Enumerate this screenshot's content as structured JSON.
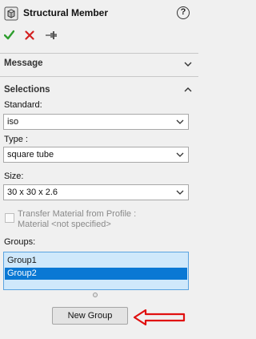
{
  "header": {
    "title": "Structural Member",
    "feature_icon": "structural-member-icon",
    "help_label": "?",
    "ok_icon": "checkmark-icon",
    "cancel_icon": "x-icon",
    "pin_icon": "pushpin-icon"
  },
  "message_section": {
    "title": "Message"
  },
  "selections_section": {
    "title": "Selections",
    "standard": {
      "label": "Standard:",
      "value": "iso"
    },
    "type": {
      "label": "Type :",
      "value": "square tube"
    },
    "size": {
      "label": "Size:",
      "value": "30 x 30 x 2.6"
    },
    "transfer_material": {
      "line1": "Transfer Material from Profile :",
      "line2": "Material <not specified>",
      "checked": false
    },
    "groups": {
      "label": "Groups:",
      "items": [
        "Group1",
        "Group2"
      ],
      "selected": "Group2"
    },
    "new_group_label": "New Group"
  },
  "colors": {
    "ok": "#2e9e2e",
    "cancel": "#d32020",
    "selection": "#0a78d4",
    "list_bg": "#cfe8fb",
    "annotation_arrow": "#e01010"
  }
}
